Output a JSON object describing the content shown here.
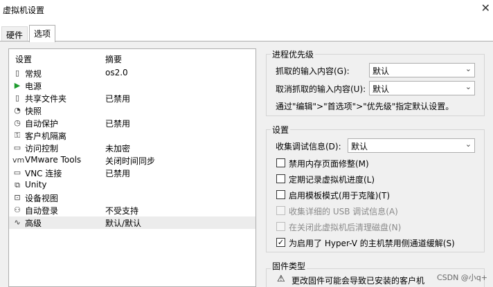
{
  "window": {
    "title": "虚拟机设置",
    "close_glyph": "✕"
  },
  "tabs": [
    {
      "label": "硬件"
    },
    {
      "label": "选项"
    }
  ],
  "list": {
    "col_setting": "设置",
    "col_summary": "摘要",
    "items": [
      {
        "name": "常规",
        "value": "os2.0",
        "icon": "▯"
      },
      {
        "name": "电源",
        "value": "",
        "icon": "▶"
      },
      {
        "name": "共享文件夹",
        "value": "已禁用",
        "icon": "▯"
      },
      {
        "name": "快照",
        "value": "",
        "icon": "◔"
      },
      {
        "name": "自动保护",
        "value": "已禁用",
        "icon": "◷"
      },
      {
        "name": "客户机隔离",
        "value": "",
        "icon": "⚿"
      },
      {
        "name": "访问控制",
        "value": "未加密",
        "icon": "▭"
      },
      {
        "name": "VMware Tools",
        "value": "关闭时间同步",
        "icon": "vm"
      },
      {
        "name": "VNC 连接",
        "value": "已禁用",
        "icon": "▭"
      },
      {
        "name": "Unity",
        "value": "",
        "icon": "⧉"
      },
      {
        "name": "设备视图",
        "value": "",
        "icon": "⊡"
      },
      {
        "name": "自动登录",
        "value": "不受支持",
        "icon": "⚇"
      },
      {
        "name": "高级",
        "value": "默认/默认",
        "icon": "∿"
      }
    ]
  },
  "priority": {
    "title": "进程优先级",
    "grab_label": "抓取的输入内容(G):",
    "grab_value": "默认",
    "ungrab_label": "取消抓取的输入内容(U):",
    "ungrab_value": "默认",
    "note": "通过\"编辑\">\"首选项\">\"优先级\"指定默认设置。"
  },
  "settings": {
    "title": "设置",
    "debug_label": "收集调试信息(D):",
    "debug_value": "默认",
    "options": [
      {
        "label": "禁用内存页面修整(M)",
        "checked": false,
        "disabled": false
      },
      {
        "label": "定期记录虚拟机进度(L)",
        "checked": false,
        "disabled": false
      },
      {
        "label": "启用模板模式(用于克隆)(T)",
        "checked": false,
        "disabled": false
      },
      {
        "label": "收集详细的 USB 调试信息(A)",
        "checked": false,
        "disabled": true
      },
      {
        "label": "在关闭此虚拟机后清理磁盘(N)",
        "checked": false,
        "disabled": true
      },
      {
        "label": "为启用了 Hyper-V 的主机禁用侧通道缓解(S)",
        "checked": true,
        "disabled": false
      }
    ]
  },
  "firmware": {
    "title": "固件类型",
    "warning_line1": "更改固件可能会导致已安装的客户机"
  },
  "watermark": "CSDN @小q+"
}
